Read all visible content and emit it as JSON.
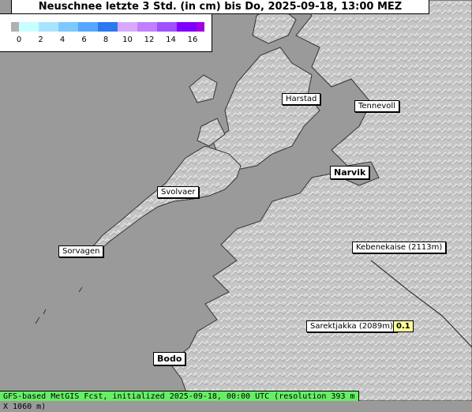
{
  "title": "Neuschnee letzte 3 Std. (in cm) bis Do, 2025-09-18, 13:00 MEZ",
  "legend": {
    "ticks": [
      "0",
      "2",
      "4",
      "6",
      "8",
      "10",
      "12",
      "14",
      "16"
    ],
    "colors": [
      "#c8ffff",
      "#a8e4ff",
      "#7cc8ff",
      "#54a8ff",
      "#2c78f0",
      "#d8a8ff",
      "#c080ff",
      "#a050ff",
      "#8000ff"
    ],
    "low_color": "#b0b0b0",
    "high_color": "#a000e0"
  },
  "places": {
    "harstad": "Harstad",
    "tennevoll": "Tennevoll",
    "narvik": "Narvik",
    "svolvaer": "Svolvaer",
    "sorvagen": "Sorvagen",
    "kebnekaise": "Kebenekaise (2113m)",
    "sarektjakka": "Sarektjakka (2089m)",
    "bodo": "Bodo"
  },
  "sarektjakka_value": "0.1",
  "footer": "GFS-based MetGIS Fcst, initialized 2025-09-18, 00:00 UTC  (resolution 393 m X 1060 m)",
  "colors": {
    "sea": "#9a9a9a",
    "land": "#c4c4c4",
    "footer_bg": "#66ee66"
  }
}
